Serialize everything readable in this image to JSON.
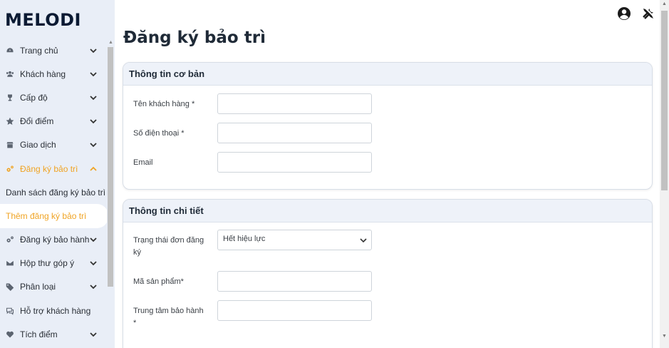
{
  "app": {
    "brand": "MELODI"
  },
  "sidebar": {
    "items": [
      {
        "label": "Trang chủ",
        "icon": "dashboard-icon"
      },
      {
        "label": "Khách hàng",
        "icon": "users-icon"
      },
      {
        "label": "Cấp độ",
        "icon": "trophy-icon"
      },
      {
        "label": "Đổi điểm",
        "icon": "star-icon"
      },
      {
        "label": "Giao dịch",
        "icon": "shop-icon"
      },
      {
        "label": "Đăng ký bảo trì",
        "icon": "cogs-icon",
        "active": true
      },
      {
        "label": "Đăng ký bảo hành",
        "icon": "cogs-icon"
      },
      {
        "label": "Hộp thư góp ý",
        "icon": "envelope-icon"
      },
      {
        "label": "Phân loại",
        "icon": "tags-icon"
      },
      {
        "label": "Hỗ trợ khách hàng",
        "icon": "chat-icon"
      },
      {
        "label": "Tích điểm",
        "icon": "heart-icon"
      }
    ],
    "subitems": [
      {
        "label": "Danh sách đăng ký bảo trì"
      },
      {
        "label": "Thêm đăng ký bảo trì",
        "current": true
      }
    ]
  },
  "header": {
    "icons": [
      "user-circle-icon",
      "tools-icon"
    ]
  },
  "page": {
    "title": "Đăng ký bảo trì"
  },
  "basic_info": {
    "title": "Thông tin cơ bản",
    "customer_name_label": "Tên khách hàng *",
    "customer_name_value": "",
    "phone_label": "Số điện thoại *",
    "phone_value": "",
    "email_label": "Email",
    "email_value": ""
  },
  "details": {
    "title": "Thông tin chi tiết",
    "status_label": "Trạng thái đơn đăng ký",
    "status_value": "Hết hiệu lực",
    "product_code_label": "Mã sản phẩm*",
    "product_code_value": "",
    "warranty_center_label": "Trung tâm bảo hành *",
    "warranty_center_value": ""
  },
  "colors": {
    "accent": "#f0a424",
    "sidebar_bg": "#e9eef7",
    "card_head_bg": "#eef2f9"
  }
}
